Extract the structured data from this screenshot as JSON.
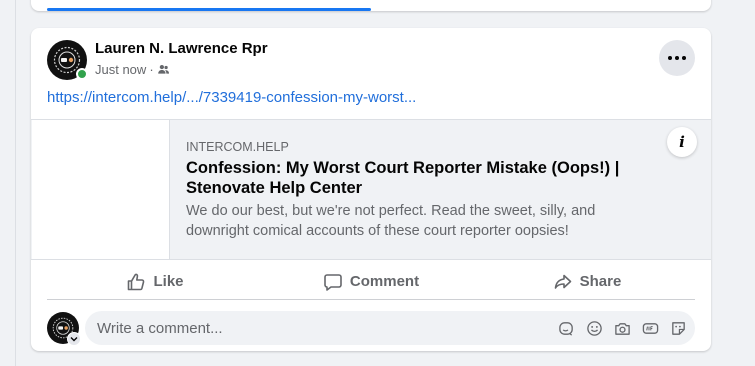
{
  "post": {
    "author": "Lauren N. Lawrence Rpr",
    "timestamp": "Just now",
    "meta_separator": "·",
    "link_text": "https://intercom.help/.../7339419-confession-my-worst...",
    "audience_icon": "friends-icon",
    "online": true
  },
  "link_preview": {
    "domain": "INTERCOM.HELP",
    "title": "Confession: My Worst Court Reporter Mistake (Oops!) | Stenovate Help Center",
    "description": "We do our best, but we're not perfect. Read the sweet, silly, and downright comical accounts of these court reporter oopsies!",
    "info_label": "i"
  },
  "actions": {
    "like": "Like",
    "comment": "Comment",
    "share": "Share"
  },
  "comment_box": {
    "placeholder": "Write a comment...",
    "icons": [
      "avatar-sticker-icon",
      "emoji-icon",
      "camera-icon",
      "gif-icon",
      "sticker-icon"
    ]
  },
  "colors": {
    "link": "#216fdb",
    "online": "#31a24c",
    "progress": "#1877f2",
    "secondary_text": "#65676b"
  }
}
